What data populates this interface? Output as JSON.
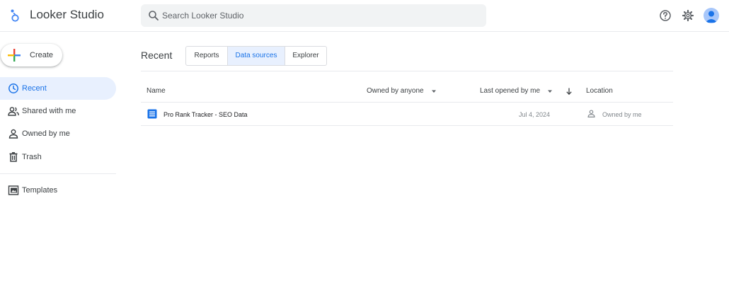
{
  "app": {
    "title": "Looker Studio",
    "accent_color": "#1a73e8",
    "logo_icon": "looker-studio-logo-icon"
  },
  "search": {
    "placeholder": "Search Looker Studio",
    "value": ""
  },
  "header_icons": [
    "help-icon",
    "settings-gear-icon",
    "account-avatar"
  ],
  "sidebar": {
    "create_label": "Create",
    "items": [
      {
        "label": "Recent",
        "icon": "clock-icon",
        "active": true
      },
      {
        "label": "Shared with me",
        "icon": "people-icon",
        "active": false
      },
      {
        "label": "Owned by me",
        "icon": "person-icon",
        "active": false
      },
      {
        "label": "Trash",
        "icon": "trash-icon",
        "active": false
      },
      {
        "label": "Templates",
        "icon": "templates-icon",
        "active": false
      }
    ]
  },
  "main": {
    "title": "Recent",
    "tabs": [
      {
        "label": "Reports",
        "active": false
      },
      {
        "label": "Data sources",
        "active": true
      },
      {
        "label": "Explorer",
        "active": false
      }
    ],
    "table": {
      "columns": [
        "Name",
        "Owned by anyone",
        "Last opened by me",
        "Location"
      ],
      "rows": [
        {
          "name": "Pro Rank Tracker - SEO Data",
          "last_opened": "Jul 4, 2024",
          "location": "Owned by me",
          "icon": "data-source-icon"
        }
      ]
    }
  }
}
